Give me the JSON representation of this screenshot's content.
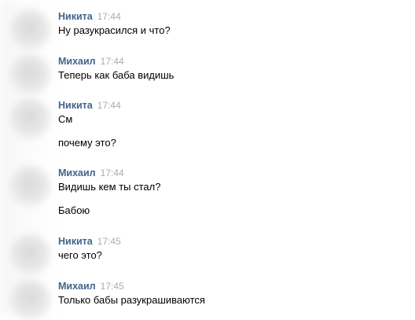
{
  "messages": [
    {
      "author": "Никита",
      "time": "17:44",
      "lines": [
        "Ну разукрасился и что?"
      ]
    },
    {
      "author": "Михаил",
      "time": "17:44",
      "lines": [
        "Теперь как баба видишь"
      ]
    },
    {
      "author": "Никита",
      "time": "17:44",
      "lines": [
        "См",
        "почему это?"
      ]
    },
    {
      "author": "Михаил",
      "time": "17:44",
      "lines": [
        "Видишь кем ты стал?",
        "Бабою"
      ]
    },
    {
      "author": "Никита",
      "time": "17:45",
      "lines": [
        "чего это?"
      ]
    },
    {
      "author": "Михаил",
      "time": "17:45",
      "lines": [
        "Только бабы разукрашиваются"
      ]
    }
  ]
}
